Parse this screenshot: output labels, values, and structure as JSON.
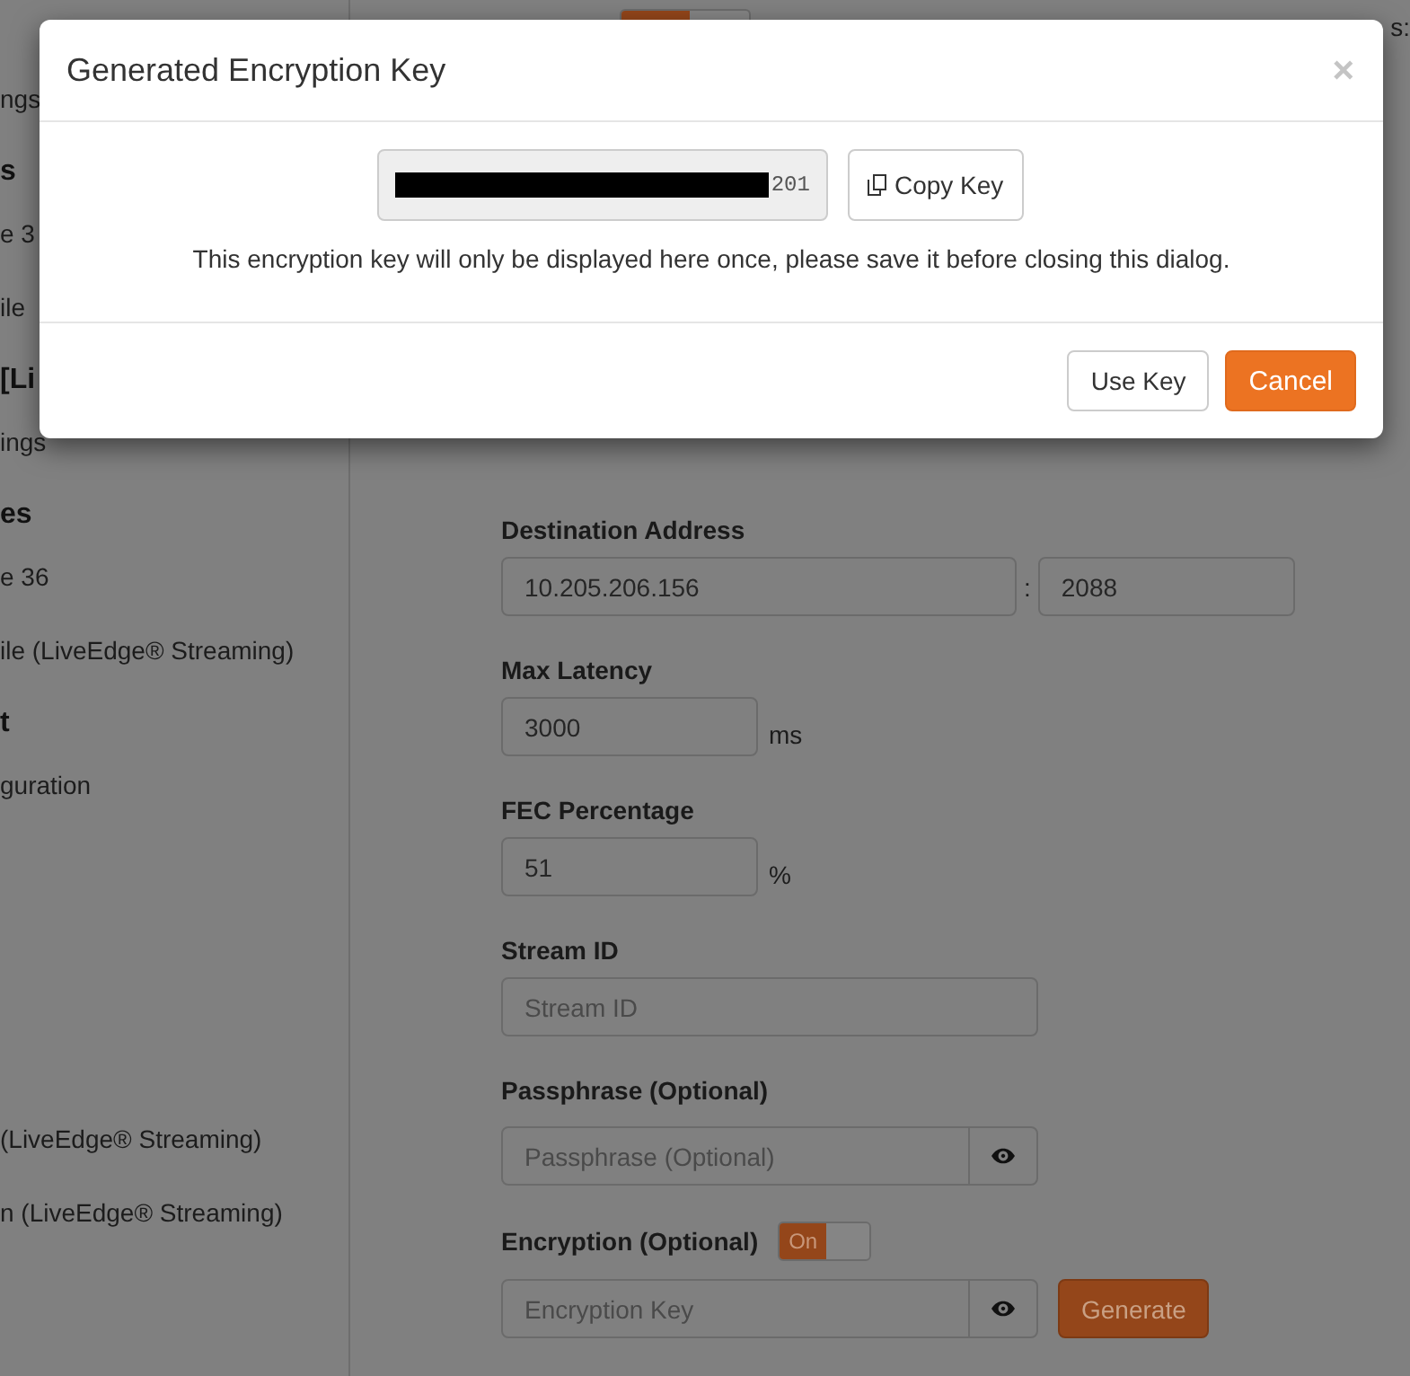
{
  "page": {
    "header": {
      "toggle": {
        "on": true
      },
      "status_text": "s:"
    },
    "sidebar": {
      "sections": [
        {
          "items": [
            {
              "kind": "item",
              "text": "ngs"
            },
            {
              "kind": "heading",
              "text": "s"
            },
            {
              "kind": "item",
              "text": "e 3"
            },
            {
              "kind": "item",
              "text": "ile"
            },
            {
              "kind": "heading",
              "text": "[Li"
            },
            {
              "kind": "item",
              "text": "ings"
            },
            {
              "kind": "heading",
              "text": "es"
            },
            {
              "kind": "item",
              "text": "e 36"
            },
            {
              "kind": "item",
              "text": "ile (LiveEdge® Streaming)"
            },
            {
              "kind": "heading",
              "text": "t"
            },
            {
              "kind": "item",
              "text": "guration"
            }
          ]
        },
        {
          "items": [
            {
              "kind": "item",
              "text": "(LiveEdge® Streaming)"
            },
            {
              "kind": "item",
              "text": "n (LiveEdge® Streaming)"
            }
          ]
        }
      ]
    },
    "form": {
      "fields": [
        {
          "kind": "address",
          "label": "Destination Address",
          "host": "10.205.206.156",
          "separator": ":",
          "port": "2088"
        },
        {
          "kind": "unit",
          "label": "Max Latency",
          "value": "3000",
          "unit": "ms"
        },
        {
          "kind": "unit",
          "label": "FEC Percentage",
          "value": "51",
          "unit": "%"
        },
        {
          "kind": "text",
          "label": "Stream ID",
          "placeholder": "Stream ID"
        },
        {
          "kind": "secret",
          "label": "Passphrase (Optional)",
          "placeholder": "Passphrase (Optional)"
        },
        {
          "kind": "encryption",
          "label": "Encryption (Optional)",
          "toggle": {
            "on": true,
            "label": "On"
          },
          "placeholder": "Encryption Key",
          "button": "Generate"
        }
      ]
    }
  },
  "dialog": {
    "title": "Generated Encryption Key",
    "close": "×",
    "key_field": {
      "redacted": true,
      "value": "201"
    },
    "copy_button": "Copy Key",
    "message": "This encryption key will only be displayed here once, please save it before closing this dialog.",
    "buttons": [
      {
        "kind": "default",
        "label": "Use Key"
      },
      {
        "kind": "primary",
        "label": "Cancel"
      }
    ]
  }
}
